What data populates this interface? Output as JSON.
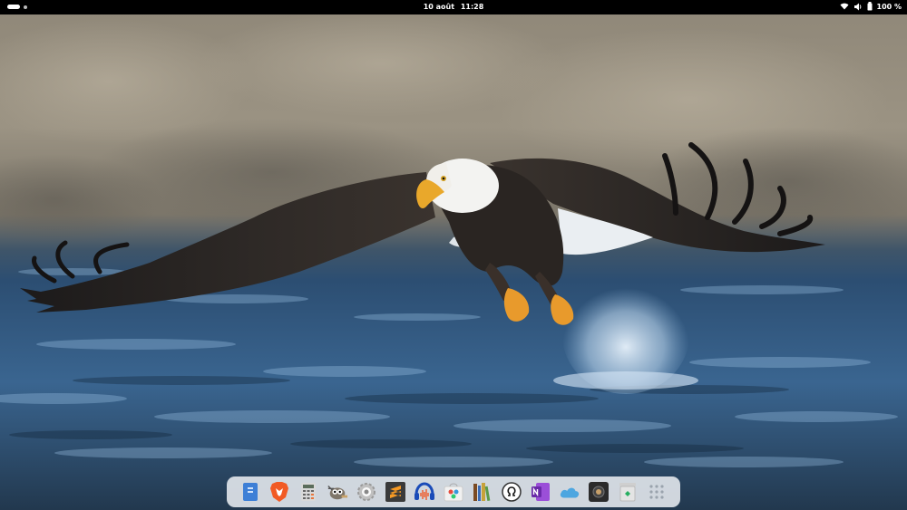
{
  "topbar": {
    "date": "10 août",
    "time": "11:28",
    "battery": "100 %"
  },
  "dock": {
    "apps": [
      {
        "icon": "files-icon"
      },
      {
        "icon": "brave-browser-icon"
      },
      {
        "icon": "calculator-icon"
      },
      {
        "icon": "gimp-icon"
      },
      {
        "icon": "settings-icon"
      },
      {
        "icon": "sublime-text-icon"
      },
      {
        "icon": "audacity-icon"
      },
      {
        "icon": "software-store-icon"
      },
      {
        "icon": "books-library-icon"
      },
      {
        "icon": "system-update-icon"
      },
      {
        "icon": "onenote-icon"
      },
      {
        "icon": "cloud-sync-icon"
      },
      {
        "icon": "screen-recorder-icon"
      },
      {
        "icon": "trash-icon"
      },
      {
        "icon": "app-grid-icon"
      }
    ]
  },
  "colors": {
    "topbar_bg": "#000000",
    "dock_bg": "#e8ecf0",
    "water": "#2e5a86",
    "eagle_body": "#2a2522"
  }
}
